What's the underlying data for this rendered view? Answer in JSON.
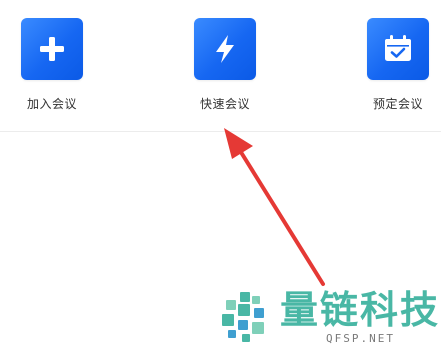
{
  "actions": [
    {
      "label": "加入会议",
      "icon": "plus-icon"
    },
    {
      "label": "快速会议",
      "icon": "lightning-icon"
    },
    {
      "label": "预定会议",
      "icon": "calendar-check-icon"
    }
  ],
  "watermark": {
    "name": "量链科技",
    "url": "QFSP.NET"
  },
  "colors": {
    "tile": "#1667f2",
    "pointer": "#e53935",
    "watermark": "#49b7a5"
  }
}
